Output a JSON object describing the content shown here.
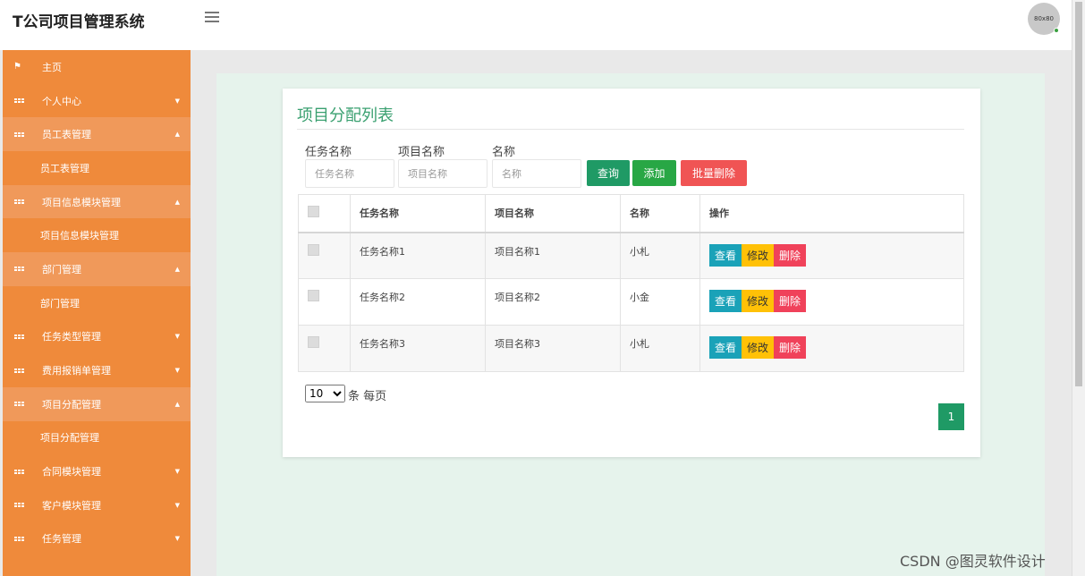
{
  "header": {
    "brand": "T公司项目管理系统",
    "avatar_text": "80x80"
  },
  "sidebar": {
    "items": [
      {
        "label": "主页",
        "icon": "flag-icon"
      },
      {
        "label": "个人中心",
        "icon": "grid-icon",
        "caret": "▼"
      },
      {
        "label": "员工表管理",
        "icon": "grid-icon",
        "caret": "▲",
        "open": true,
        "sub": "员工表管理"
      },
      {
        "label": "项目信息模块管理",
        "icon": "grid-icon",
        "caret": "▲",
        "open": true,
        "sub": "项目信息模块管理"
      },
      {
        "label": "部门管理",
        "icon": "grid-icon",
        "caret": "▲",
        "open": true,
        "sub": "部门管理"
      },
      {
        "label": "任务类型管理",
        "icon": "grid-icon",
        "caret": "▼"
      },
      {
        "label": "费用报销单管理",
        "icon": "grid-icon",
        "caret": "▼"
      },
      {
        "label": "项目分配管理",
        "icon": "grid-icon",
        "caret": "▲",
        "open": true,
        "sub": "项目分配管理"
      },
      {
        "label": "合同模块管理",
        "icon": "grid-icon",
        "caret": "▼"
      },
      {
        "label": "客户模块管理",
        "icon": "grid-icon",
        "caret": "▼"
      },
      {
        "label": "任务管理",
        "icon": "grid-icon",
        "caret": "▼"
      }
    ]
  },
  "panel": {
    "title": "项目分配列表",
    "filters": [
      {
        "label": "任务名称",
        "placeholder": "任务名称"
      },
      {
        "label": "项目名称",
        "placeholder": "项目名称"
      },
      {
        "label": "名称",
        "placeholder": "名称"
      }
    ],
    "buttons": {
      "query": "查询",
      "add": "添加",
      "batch_delete": "批量删除"
    },
    "table": {
      "headers": [
        "任务名称",
        "项目名称",
        "名称",
        "操作"
      ],
      "rows": [
        {
          "task": "任务名称1",
          "project": "项目名称1",
          "name": "小札"
        },
        {
          "task": "任务名称2",
          "project": "项目名称2",
          "name": "小金"
        },
        {
          "task": "任务名称3",
          "project": "项目名称3",
          "name": "小札"
        }
      ],
      "actions": {
        "view": "查看",
        "edit": "修改",
        "delete": "删除"
      }
    },
    "pager": {
      "page_size": "10",
      "per_page_text": "条 每页",
      "current_page": "1"
    }
  },
  "watermark": "CSDN @图灵软件设计",
  "colors": {
    "sidebar": "#ef8a3b",
    "accent_green": "#1f9a65",
    "title_green": "#3aa070"
  }
}
